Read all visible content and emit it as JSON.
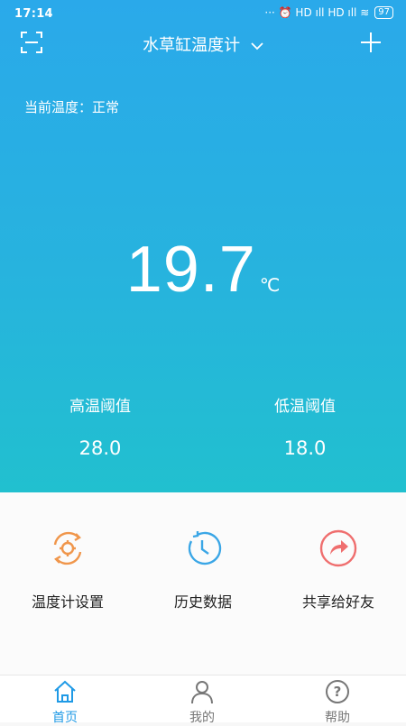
{
  "statusbar": {
    "time": "17:14",
    "indicators": "··· ⏰ HD ıll HD ıll ≋",
    "battery": "97"
  },
  "header": {
    "title": "水草缸温度计"
  },
  "status": {
    "text": "当前温度：正常"
  },
  "temperature": {
    "value": "19.7",
    "unit": "℃"
  },
  "thresholds": {
    "high": {
      "label": "高温阈值",
      "value": "28.0"
    },
    "low": {
      "label": "低温阈值",
      "value": "18.0"
    }
  },
  "actions": [
    {
      "label": "温度计设置",
      "icon": "gear-sync-icon",
      "color": "#f0964b"
    },
    {
      "label": "历史数据",
      "icon": "clock-history-icon",
      "color": "#3aa6e6"
    },
    {
      "label": "共享给好友",
      "icon": "share-arrow-icon",
      "color": "#ef6e6e"
    }
  ],
  "tabs": [
    {
      "label": "首页",
      "icon": "home-icon",
      "active": true
    },
    {
      "label": "我的",
      "icon": "user-icon",
      "active": false
    },
    {
      "label": "帮助",
      "icon": "help-icon",
      "active": false
    }
  ],
  "colors": {
    "accent": "#1f9ae6",
    "hero_top": "#2aa9ea",
    "hero_bottom": "#21c0cf"
  }
}
